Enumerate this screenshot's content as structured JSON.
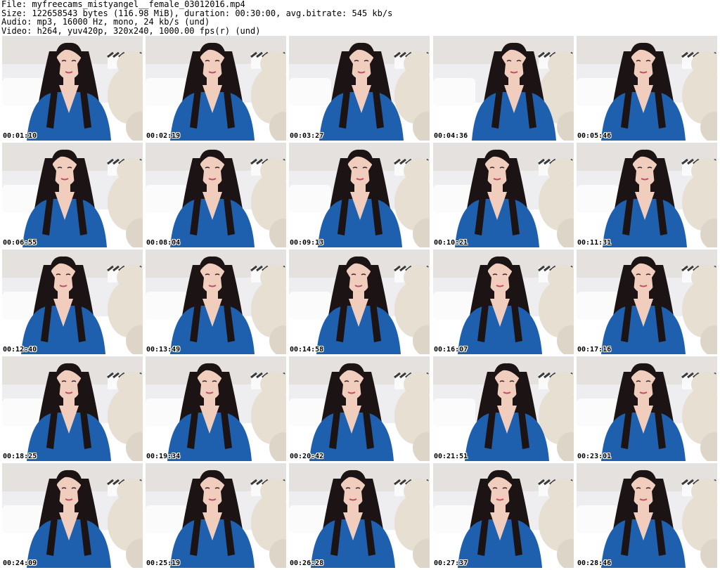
{
  "file_info": {
    "file": "File: myfreecams_mistyangel__female_03012016.mp4",
    "size": "Size: 122658543 bytes (116.98 MiB), duration: 00:30:00, avg.bitrate: 545 kb/s",
    "audio": "Audio: mp3, 16000 Hz, mono, 24 kb/s (und)",
    "video": "Video: h264, yuv420p, 320x240, 1000.00 fps(r) (und)"
  },
  "colors": {
    "sweater": "#1e5fae",
    "hair": "#1c1414",
    "skin": "#f1cdbd",
    "wall": "#eeeef0",
    "sheet": "#ffffff",
    "teddy": "#e6dfd2",
    "pillow_stripe": "#3a3a3a"
  },
  "thumbnails": [
    {
      "timestamp": "00:01:10"
    },
    {
      "timestamp": "00:02:19"
    },
    {
      "timestamp": "00:03:27"
    },
    {
      "timestamp": "00:04:36"
    },
    {
      "timestamp": "00:05:46"
    },
    {
      "timestamp": "00:06:55"
    },
    {
      "timestamp": "00:08:04"
    },
    {
      "timestamp": "00:09:13"
    },
    {
      "timestamp": "00:10:21"
    },
    {
      "timestamp": "00:11:31"
    },
    {
      "timestamp": "00:12:40"
    },
    {
      "timestamp": "00:13:49"
    },
    {
      "timestamp": "00:14:58"
    },
    {
      "timestamp": "00:16:07"
    },
    {
      "timestamp": "00:17:16"
    },
    {
      "timestamp": "00:18:25"
    },
    {
      "timestamp": "00:19:34"
    },
    {
      "timestamp": "00:20:42"
    },
    {
      "timestamp": "00:21:51"
    },
    {
      "timestamp": "00:23:01"
    },
    {
      "timestamp": "00:24:09"
    },
    {
      "timestamp": "00:25:19"
    },
    {
      "timestamp": "00:26:28"
    },
    {
      "timestamp": "00:27:37"
    },
    {
      "timestamp": "00:28:46"
    }
  ]
}
